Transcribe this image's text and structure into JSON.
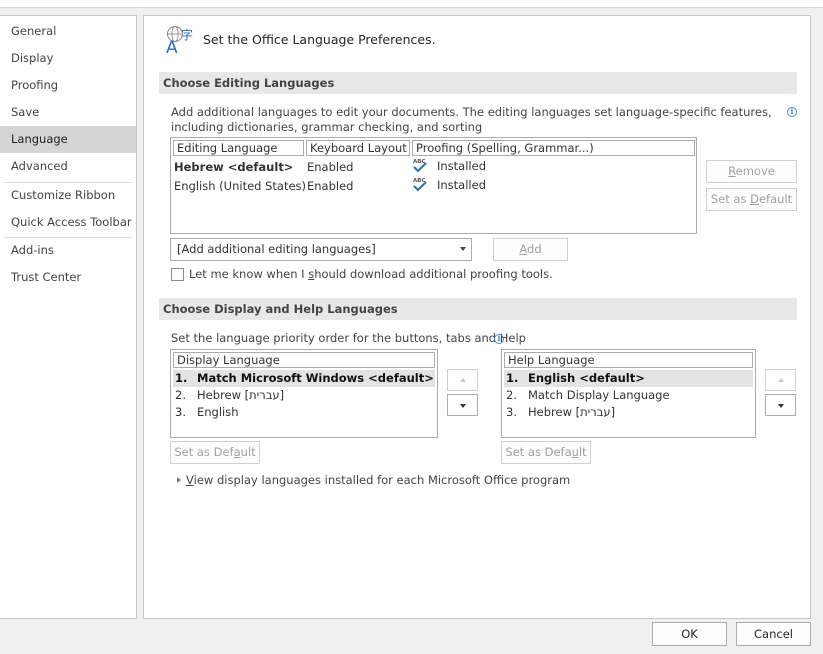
{
  "sidebar": {
    "items": [
      {
        "label": "General"
      },
      {
        "label": "Display"
      },
      {
        "label": "Proofing"
      },
      {
        "label": "Save"
      },
      {
        "label": "Language",
        "selected": true
      },
      {
        "label": "Advanced"
      },
      {
        "label": "Customize Ribbon"
      },
      {
        "label": "Quick Access Toolbar"
      },
      {
        "label": "Add-ins"
      },
      {
        "label": "Trust Center"
      }
    ]
  },
  "page": {
    "icon": "language-icon",
    "title": "Set the Office Language Preferences."
  },
  "editing": {
    "section_title": "Choose Editing Languages",
    "description": "Add additional languages to edit your documents. The editing languages set language-specific features, including dictionaries, grammar checking, and sorting",
    "columns": [
      "Editing Language",
      "Keyboard Layout",
      "Proofing (Spelling, Grammar...)"
    ],
    "rows": [
      {
        "language": "Hebrew <default>",
        "keyboard": "Enabled",
        "proofing": "Installed",
        "is_default": true
      },
      {
        "language": "English (United States)",
        "keyboard": "Enabled",
        "proofing": "Installed",
        "is_default": false
      }
    ],
    "remove_button": {
      "pre": "",
      "accel": "R",
      "post": "emove"
    },
    "set_default_button": {
      "pre": "Set as ",
      "accel": "D",
      "post": "efault"
    },
    "add_combo": {
      "value": "[Add additional editing languages]"
    },
    "add_button": {
      "pre": "",
      "accel": "A",
      "post": "dd"
    },
    "checkbox_label": {
      "pre": "Let me know when I ",
      "accel": "s",
      "post": "hould download additional proofing tools."
    },
    "checkbox_checked": false
  },
  "display": {
    "section_title": "Choose Display and Help Languages",
    "description": "Set the language priority order for the buttons, tabs and Help",
    "display_list": {
      "header": "Display Language",
      "items": [
        {
          "num": "1.",
          "label": "Match Microsoft Windows <default>",
          "selected": true
        },
        {
          "num": "2.",
          "label": "Hebrew [עברית]",
          "selected": false
        },
        {
          "num": "3.",
          "label": "English",
          "selected": false
        }
      ],
      "set_default_button": {
        "pre": "Set as Def",
        "accel": "a",
        "post": "ult"
      }
    },
    "help_list": {
      "header": "Help Language",
      "items": [
        {
          "num": "1.",
          "label": "English <default>",
          "selected": true
        },
        {
          "num": "2.",
          "label": "Match Display Language",
          "selected": false
        },
        {
          "num": "3.",
          "label": "Hebrew [עברית]",
          "selected": false
        }
      ],
      "set_default_button": {
        "pre": "Set as Defa",
        "accel": "u",
        "post": "lt"
      }
    },
    "expander_label": {
      "pre": "",
      "accel": "V",
      "post": "iew display languages installed for each Microsoft Office program"
    }
  },
  "dialog": {
    "ok_label": "OK",
    "cancel_label": "Cancel"
  },
  "colors": {
    "selected_nav": "#d5d5d5",
    "section_header": "#e8e8e8",
    "info_blue": "#2b7cd3",
    "check_blue": "#2e75b6"
  }
}
